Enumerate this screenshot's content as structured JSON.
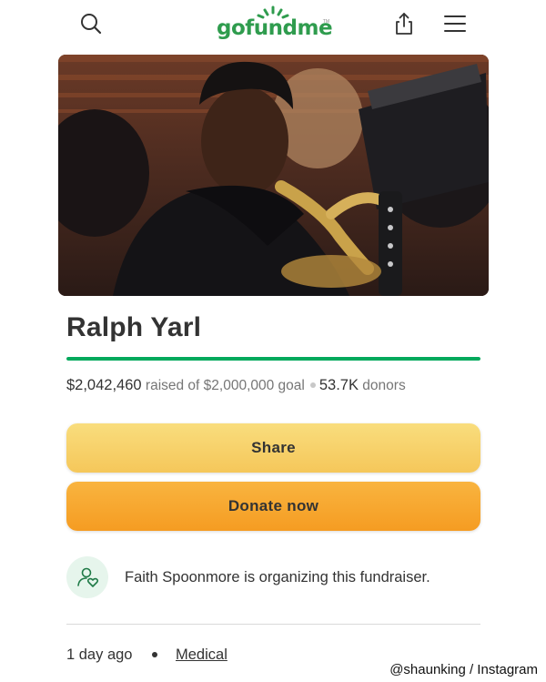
{
  "header": {
    "logo_text": "gofundme",
    "logo_tm": "TM",
    "icons": [
      "search-icon",
      "share-icon",
      "menu-icon"
    ],
    "brand_color": "#02a95c"
  },
  "campaign": {
    "photo": "musician-with-clarinet",
    "title": "Ralph Yarl",
    "raised": "$2,042,460",
    "raised_label": "raised of $2,000,000 goal",
    "donors_count": "53.7K",
    "donors_label": "donors",
    "progress_fraction": 1.0
  },
  "actions": {
    "share_label": "Share",
    "donate_label": "Donate now"
  },
  "organizer": {
    "icon": "heart-person-icon",
    "text": "Faith Spoonmore is organizing this fundraiser."
  },
  "meta": {
    "time": "1 day ago",
    "category": "Medical"
  },
  "credit": "@shaunking / Instagram"
}
